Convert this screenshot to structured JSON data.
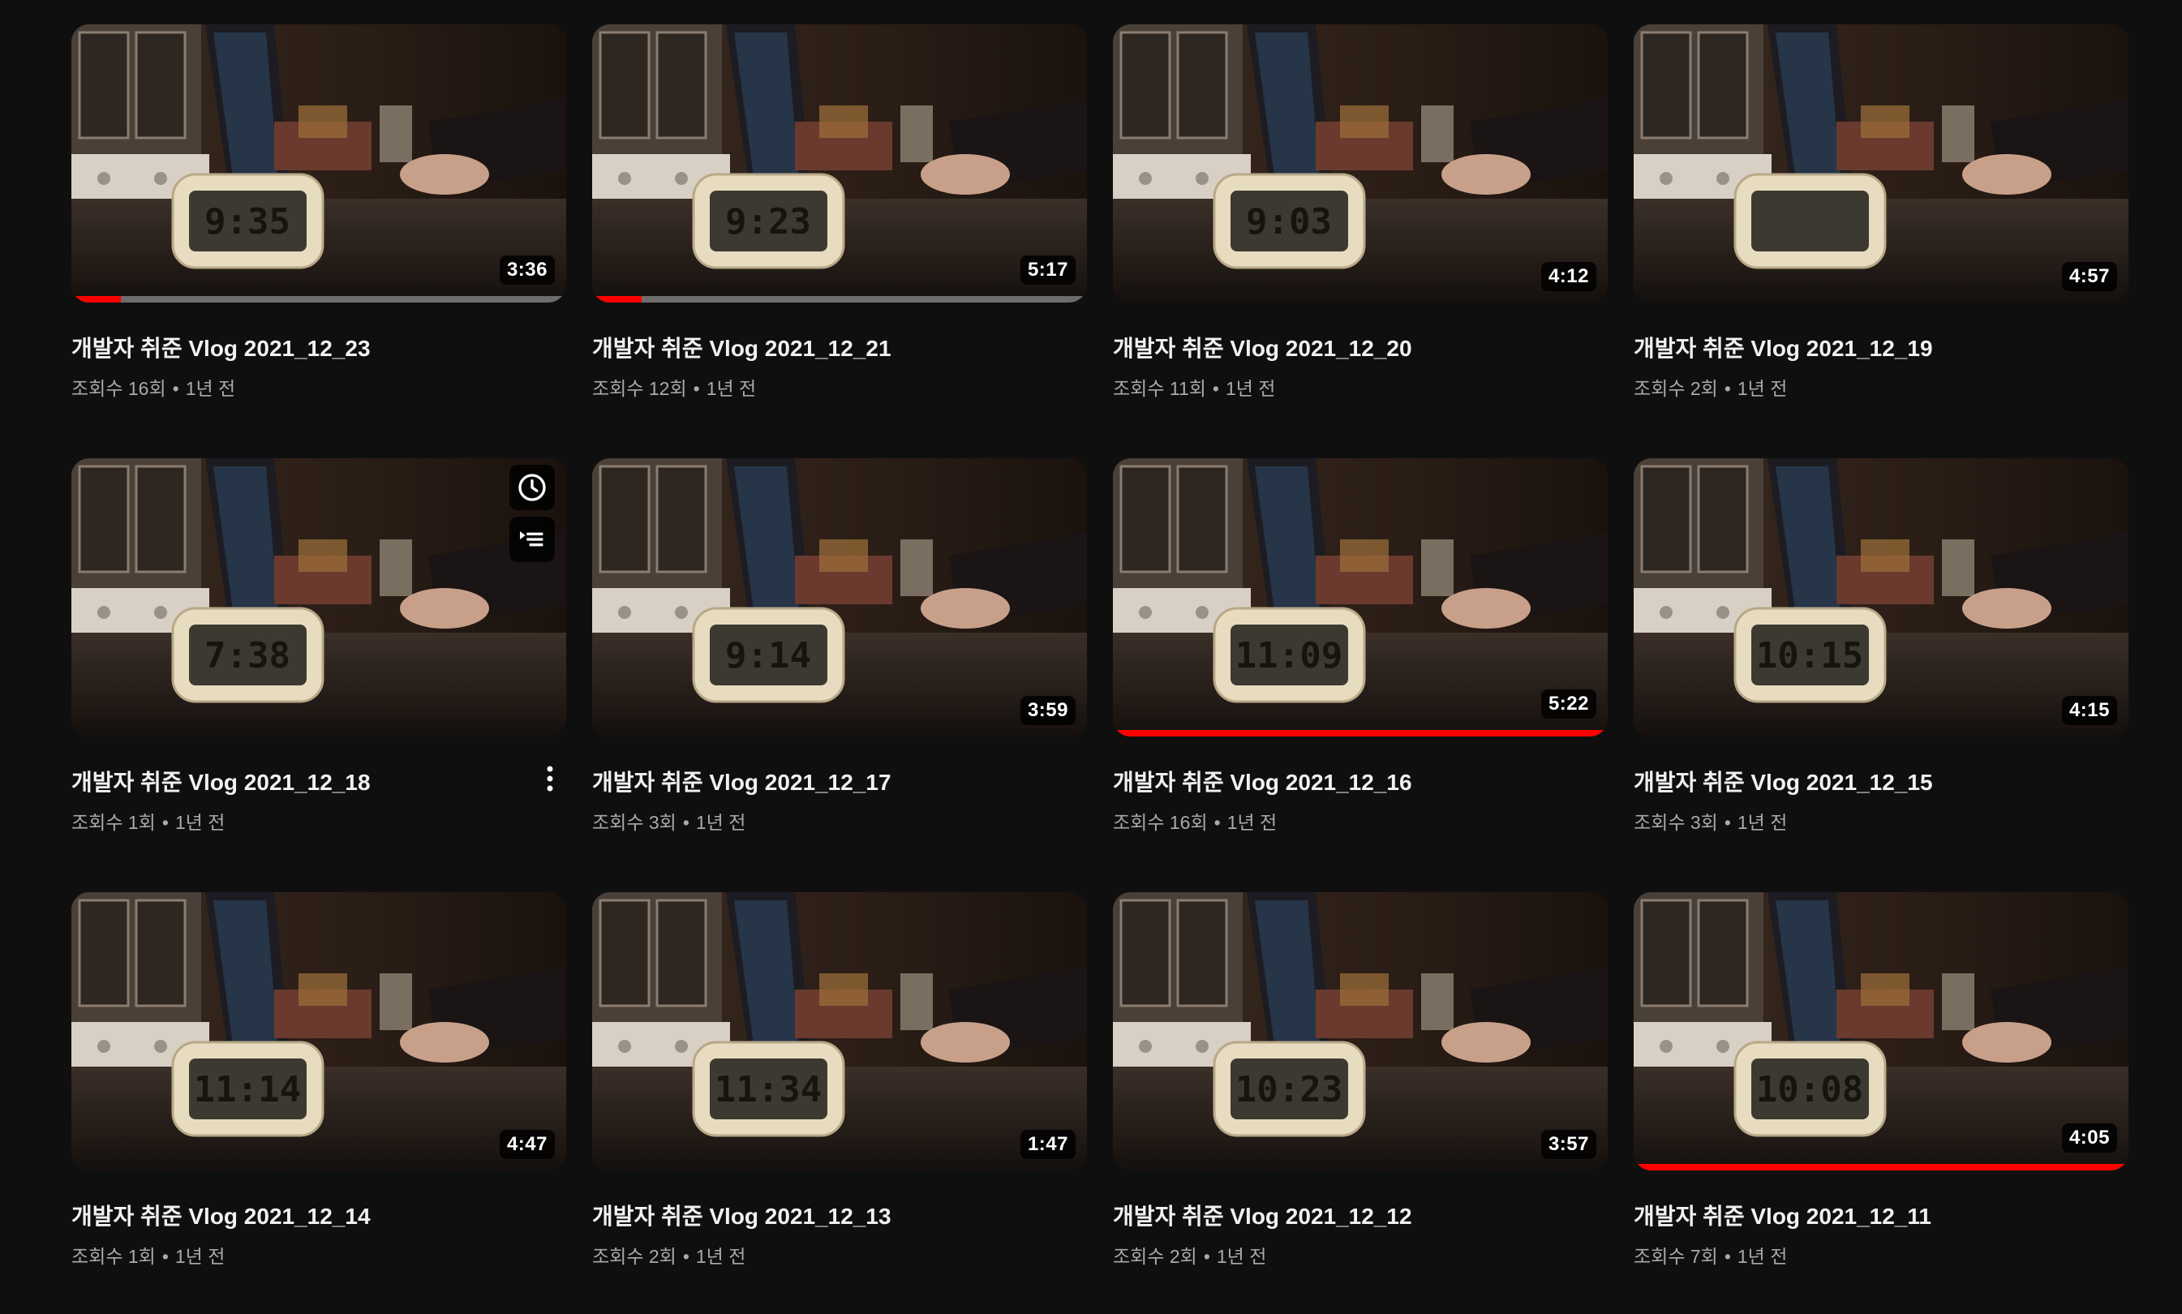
{
  "videos": [
    {
      "title": "개발자 취준 Vlog 2021_12_23",
      "views": "조회수 16회",
      "age": "1년 전",
      "duration": "3:36",
      "progress": 0.1,
      "clock": "9:35"
    },
    {
      "title": "개발자 취준 Vlog 2021_12_21",
      "views": "조회수 12회",
      "age": "1년 전",
      "duration": "5:17",
      "progress": 0.1,
      "clock": "9:23"
    },
    {
      "title": "개발자 취준 Vlog 2021_12_20",
      "views": "조회수 11회",
      "age": "1년 전",
      "duration": "4:12",
      "progress": null,
      "clock": "9:03"
    },
    {
      "title": "개발자 취준 Vlog 2021_12_19",
      "views": "조회수 2회",
      "age": "1년 전",
      "duration": "4:57",
      "progress": null,
      "clock": ""
    },
    {
      "title": "개발자 취준 Vlog 2021_12_18",
      "views": "조회수 1회",
      "age": "1년 전",
      "duration": "",
      "progress": null,
      "clock": "7:38",
      "hovered": true
    },
    {
      "title": "개발자 취준 Vlog 2021_12_17",
      "views": "조회수 3회",
      "age": "1년 전",
      "duration": "3:59",
      "progress": null,
      "clock": "9:14"
    },
    {
      "title": "개발자 취준 Vlog 2021_12_16",
      "views": "조회수 16회",
      "age": "1년 전",
      "duration": "5:22",
      "progress": 1.0,
      "clock": "11:09"
    },
    {
      "title": "개발자 취준 Vlog 2021_12_15",
      "views": "조회수 3회",
      "age": "1년 전",
      "duration": "4:15",
      "progress": null,
      "clock": "10:15"
    },
    {
      "title": "개발자 취준 Vlog 2021_12_14",
      "views": "조회수 1회",
      "age": "1년 전",
      "duration": "4:47",
      "progress": null,
      "clock": "11:14"
    },
    {
      "title": "개발자 취준 Vlog 2021_12_13",
      "views": "조회수 2회",
      "age": "1년 전",
      "duration": "1:47",
      "progress": null,
      "clock": "11:34"
    },
    {
      "title": "개발자 취준 Vlog 2021_12_12",
      "views": "조회수 2회",
      "age": "1년 전",
      "duration": "3:57",
      "progress": null,
      "clock": "10:23"
    },
    {
      "title": "개발자 취준 Vlog 2021_12_11",
      "views": "조회수 7회",
      "age": "1년 전",
      "duration": "4:05",
      "progress": 1.0,
      "clock": "10:08"
    }
  ],
  "hover_actions": {
    "watch_later_icon": "clock-icon",
    "add_to_queue_icon": "queue-icon"
  },
  "colors": {
    "background": "#0f0f0f",
    "progress": "#ff0000",
    "meta_text": "#aaaaaa"
  }
}
